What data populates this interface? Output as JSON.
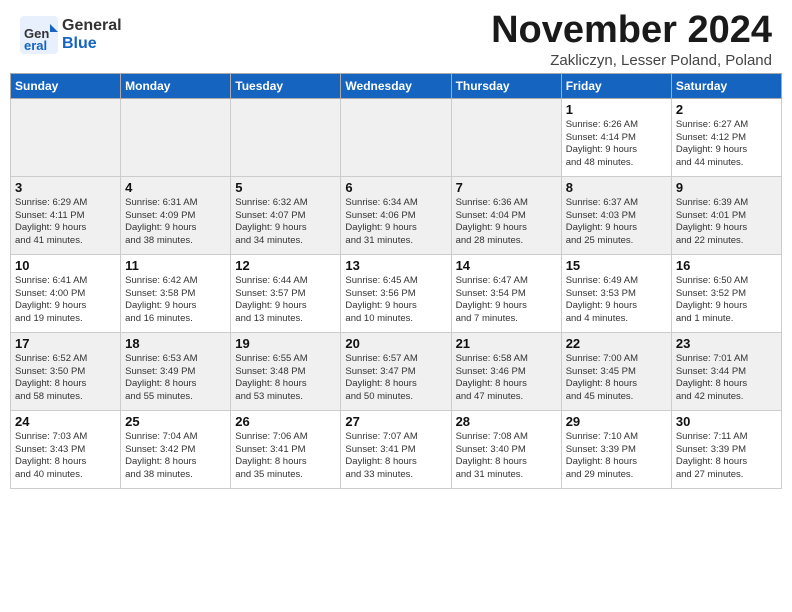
{
  "header": {
    "logo_general": "General",
    "logo_blue": "Blue",
    "month_title": "November 2024",
    "location": "Zakliczyn, Lesser Poland, Poland"
  },
  "calendar": {
    "days_of_week": [
      "Sunday",
      "Monday",
      "Tuesday",
      "Wednesday",
      "Thursday",
      "Friday",
      "Saturday"
    ],
    "weeks": [
      [
        {
          "day": "",
          "empty": true
        },
        {
          "day": "",
          "empty": true
        },
        {
          "day": "",
          "empty": true
        },
        {
          "day": "",
          "empty": true
        },
        {
          "day": "",
          "empty": true
        },
        {
          "day": "1",
          "detail": "Sunrise: 6:26 AM\nSunset: 4:14 PM\nDaylight: 9 hours\nand 48 minutes."
        },
        {
          "day": "2",
          "detail": "Sunrise: 6:27 AM\nSunset: 4:12 PM\nDaylight: 9 hours\nand 44 minutes."
        }
      ],
      [
        {
          "day": "3",
          "detail": "Sunrise: 6:29 AM\nSunset: 4:11 PM\nDaylight: 9 hours\nand 41 minutes."
        },
        {
          "day": "4",
          "detail": "Sunrise: 6:31 AM\nSunset: 4:09 PM\nDaylight: 9 hours\nand 38 minutes."
        },
        {
          "day": "5",
          "detail": "Sunrise: 6:32 AM\nSunset: 4:07 PM\nDaylight: 9 hours\nand 34 minutes."
        },
        {
          "day": "6",
          "detail": "Sunrise: 6:34 AM\nSunset: 4:06 PM\nDaylight: 9 hours\nand 31 minutes."
        },
        {
          "day": "7",
          "detail": "Sunrise: 6:36 AM\nSunset: 4:04 PM\nDaylight: 9 hours\nand 28 minutes."
        },
        {
          "day": "8",
          "detail": "Sunrise: 6:37 AM\nSunset: 4:03 PM\nDaylight: 9 hours\nand 25 minutes."
        },
        {
          "day": "9",
          "detail": "Sunrise: 6:39 AM\nSunset: 4:01 PM\nDaylight: 9 hours\nand 22 minutes."
        }
      ],
      [
        {
          "day": "10",
          "detail": "Sunrise: 6:41 AM\nSunset: 4:00 PM\nDaylight: 9 hours\nand 19 minutes."
        },
        {
          "day": "11",
          "detail": "Sunrise: 6:42 AM\nSunset: 3:58 PM\nDaylight: 9 hours\nand 16 minutes."
        },
        {
          "day": "12",
          "detail": "Sunrise: 6:44 AM\nSunset: 3:57 PM\nDaylight: 9 hours\nand 13 minutes."
        },
        {
          "day": "13",
          "detail": "Sunrise: 6:45 AM\nSunset: 3:56 PM\nDaylight: 9 hours\nand 10 minutes."
        },
        {
          "day": "14",
          "detail": "Sunrise: 6:47 AM\nSunset: 3:54 PM\nDaylight: 9 hours\nand 7 minutes."
        },
        {
          "day": "15",
          "detail": "Sunrise: 6:49 AM\nSunset: 3:53 PM\nDaylight: 9 hours\nand 4 minutes."
        },
        {
          "day": "16",
          "detail": "Sunrise: 6:50 AM\nSunset: 3:52 PM\nDaylight: 9 hours\nand 1 minute."
        }
      ],
      [
        {
          "day": "17",
          "detail": "Sunrise: 6:52 AM\nSunset: 3:50 PM\nDaylight: 8 hours\nand 58 minutes."
        },
        {
          "day": "18",
          "detail": "Sunrise: 6:53 AM\nSunset: 3:49 PM\nDaylight: 8 hours\nand 55 minutes."
        },
        {
          "day": "19",
          "detail": "Sunrise: 6:55 AM\nSunset: 3:48 PM\nDaylight: 8 hours\nand 53 minutes."
        },
        {
          "day": "20",
          "detail": "Sunrise: 6:57 AM\nSunset: 3:47 PM\nDaylight: 8 hours\nand 50 minutes."
        },
        {
          "day": "21",
          "detail": "Sunrise: 6:58 AM\nSunset: 3:46 PM\nDaylight: 8 hours\nand 47 minutes."
        },
        {
          "day": "22",
          "detail": "Sunrise: 7:00 AM\nSunset: 3:45 PM\nDaylight: 8 hours\nand 45 minutes."
        },
        {
          "day": "23",
          "detail": "Sunrise: 7:01 AM\nSunset: 3:44 PM\nDaylight: 8 hours\nand 42 minutes."
        }
      ],
      [
        {
          "day": "24",
          "detail": "Sunrise: 7:03 AM\nSunset: 3:43 PM\nDaylight: 8 hours\nand 40 minutes."
        },
        {
          "day": "25",
          "detail": "Sunrise: 7:04 AM\nSunset: 3:42 PM\nDaylight: 8 hours\nand 38 minutes."
        },
        {
          "day": "26",
          "detail": "Sunrise: 7:06 AM\nSunset: 3:41 PM\nDaylight: 8 hours\nand 35 minutes."
        },
        {
          "day": "27",
          "detail": "Sunrise: 7:07 AM\nSunset: 3:41 PM\nDaylight: 8 hours\nand 33 minutes."
        },
        {
          "day": "28",
          "detail": "Sunrise: 7:08 AM\nSunset: 3:40 PM\nDaylight: 8 hours\nand 31 minutes."
        },
        {
          "day": "29",
          "detail": "Sunrise: 7:10 AM\nSunset: 3:39 PM\nDaylight: 8 hours\nand 29 minutes."
        },
        {
          "day": "30",
          "detail": "Sunrise: 7:11 AM\nSunset: 3:39 PM\nDaylight: 8 hours\nand 27 minutes."
        }
      ]
    ]
  }
}
